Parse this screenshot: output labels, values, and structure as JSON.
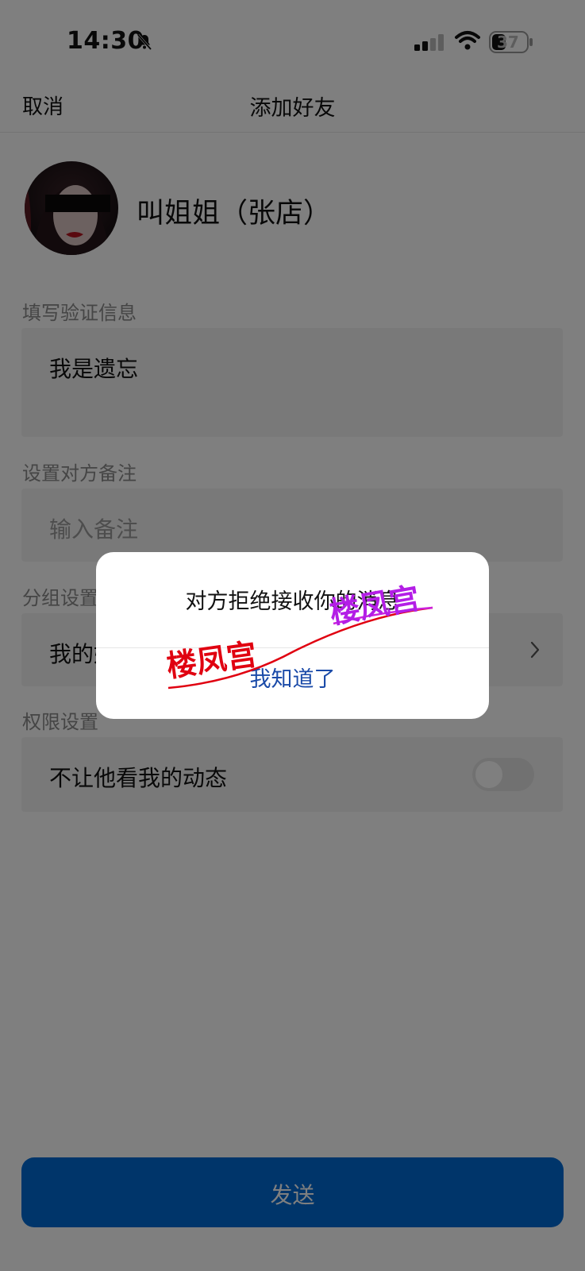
{
  "status_bar": {
    "time": "14:30",
    "battery": "37"
  },
  "nav": {
    "cancel_label": "取消",
    "title": "添加好友"
  },
  "contact": {
    "name": "叫姐姐（张店）"
  },
  "verify": {
    "label": "填写验证信息",
    "value": "我是遗忘"
  },
  "remark": {
    "label": "设置对方备注",
    "placeholder": "输入备注"
  },
  "group": {
    "label": "分组设置",
    "value": "我的好友"
  },
  "permission": {
    "label": "权限设置",
    "option_label": "不让他看我的动态",
    "enabled": false
  },
  "send": {
    "label": "发送"
  },
  "dialog": {
    "message": "对方拒绝接收你的消息",
    "button_label": "我知道了"
  },
  "watermark": {
    "text": "楼凤宫"
  }
}
